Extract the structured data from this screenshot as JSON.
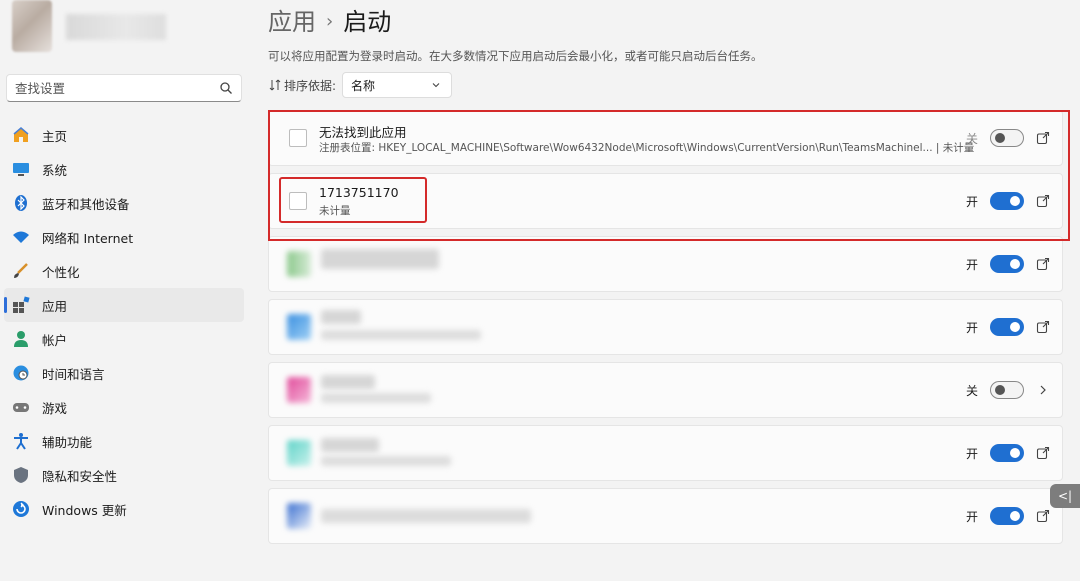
{
  "sidebar": {
    "search_placeholder": "查找设置",
    "items": [
      {
        "label": "主页",
        "icon": "home-icon",
        "active": false
      },
      {
        "label": "系统",
        "icon": "system-monitor-icon",
        "active": false
      },
      {
        "label": "蓝牙和其他设备",
        "icon": "bluetooth-icon",
        "active": false
      },
      {
        "label": "网络和 Internet",
        "icon": "network-wifi-icon",
        "active": false
      },
      {
        "label": "个性化",
        "icon": "brush-icon",
        "active": false
      },
      {
        "label": "应用",
        "icon": "apps-icon",
        "active": true
      },
      {
        "label": "帐户",
        "icon": "account-icon",
        "active": false
      },
      {
        "label": "时间和语言",
        "icon": "globe-clock-icon",
        "active": false
      },
      {
        "label": "游戏",
        "icon": "gamepad-icon",
        "active": false
      },
      {
        "label": "辅助功能",
        "icon": "accessibility-icon",
        "active": false
      },
      {
        "label": "隐私和安全性",
        "icon": "shield-icon",
        "active": false
      },
      {
        "label": "Windows 更新",
        "icon": "windows-update-icon",
        "active": false
      }
    ]
  },
  "header": {
    "crumb": "应用",
    "separator": "›",
    "title": "启动"
  },
  "description": "可以将应用配置为登录时启动。在大多数情况下应用启动后会最小化，或者可能只启动后台任务。",
  "sort": {
    "label": "排序依据:",
    "value": "名称"
  },
  "apps": [
    {
      "name": "无法找到此应用",
      "sub": "注册表位置:  HKEY_LOCAL_MACHINE\\Software\\Wow6432Node\\Microsoft\\Windows\\CurrentVersion\\Run\\TeamsMachinel...   |   未计量",
      "state": "关",
      "on": false,
      "action": "open-external-icon"
    },
    {
      "name": "1713751170",
      "sub": "未计量",
      "state": "开",
      "on": true,
      "action": "open-external-icon"
    },
    {
      "name": "",
      "sub": "",
      "state": "开",
      "on": true,
      "action": "open-external-icon"
    },
    {
      "name": "",
      "sub": "",
      "state": "开",
      "on": true,
      "action": "open-external-icon"
    },
    {
      "name": "",
      "sub": "",
      "state": "关",
      "on": false,
      "action": "chevron-right-icon"
    },
    {
      "name": "",
      "sub": "",
      "state": "开",
      "on": true,
      "action": "open-external-icon"
    },
    {
      "name": "",
      "sub": "",
      "state": "开",
      "on": true,
      "action": "open-external-icon"
    }
  ],
  "side_tab_label": "<|",
  "colors": {
    "accent": "#1f6fd1",
    "highlight": "#d42a2a"
  }
}
